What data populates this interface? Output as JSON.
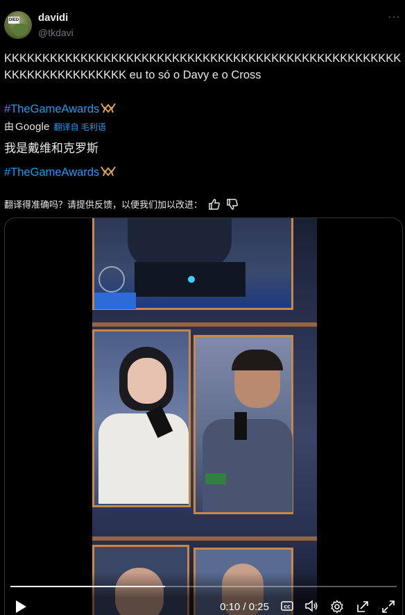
{
  "author": {
    "display_name": "davidi",
    "handle": "@tkdavi",
    "avatar_tag": "DIED",
    "more_label": "···"
  },
  "tweet": {
    "text": "KKKKKKKKKKKKKKKKKKKKKKKKKKKKKKKKKKKKKKKKKKKKKKKKKKKKKKKKKKKKKKKKKKKK eu to só o Davy e o Cross",
    "hashtag": "#TheGameAwards"
  },
  "translation": {
    "by_label": "由",
    "provider": "Google",
    "from_label": "翻译自 毛利语",
    "text": "我是戴维和克罗斯",
    "hashtag": "#TheGameAwards",
    "feedback_prompt": "翻译得准确吗？请提供反馈，以便我们加以改进："
  },
  "video": {
    "current_time": "0:10",
    "separator": "/",
    "duration": "0:25",
    "progress_fraction": 0.4
  },
  "colors": {
    "background": "#000000",
    "text": "#e7e9ea",
    "secondary": "#71767b",
    "link": "#1d9bf0",
    "panel_frame": "#c9874a"
  },
  "icons": [
    "more-icon",
    "trophy-icon",
    "thumbs-up-icon",
    "thumbs-down-icon",
    "play-icon",
    "captions-icon",
    "volume-icon",
    "settings-icon",
    "share-icon",
    "fullscreen-icon"
  ]
}
